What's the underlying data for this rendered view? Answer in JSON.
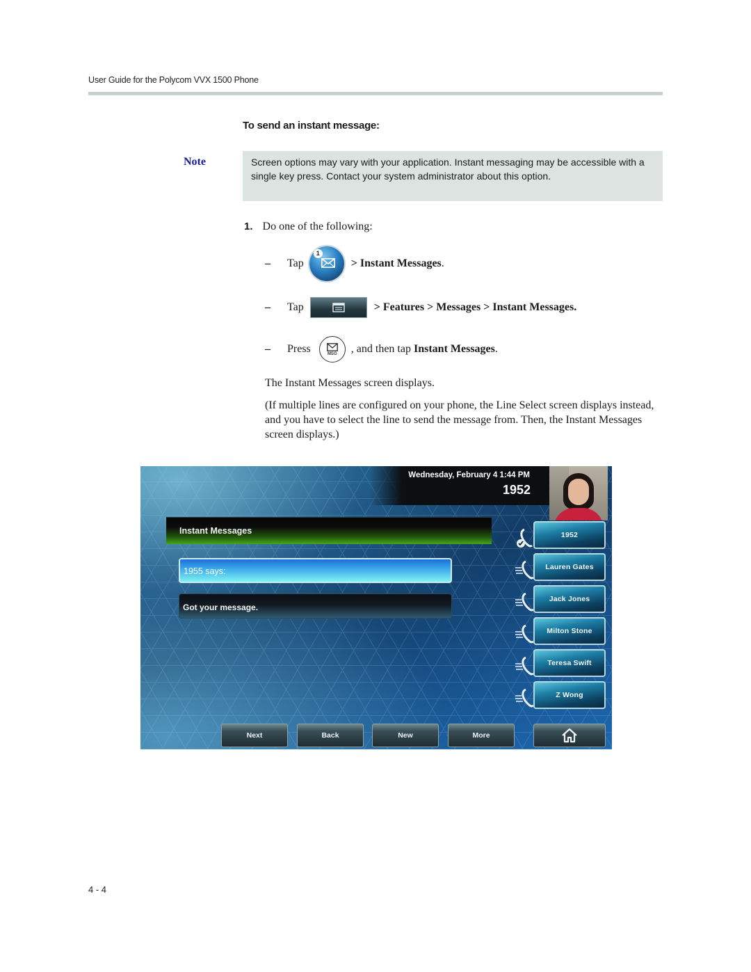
{
  "header": {
    "running_title": "User Guide for the Polycom VVX 1500 Phone"
  },
  "procedure": {
    "title": "To send an instant message:"
  },
  "note": {
    "label": "Note",
    "text": "Screen options may vary with your application. Instant messaging may be accessible with a single key press. Contact your system administrator about this option."
  },
  "steps": [
    {
      "number": "1.",
      "text": "Do one of the following:",
      "options": [
        {
          "lead": "Tap",
          "icon": "messages-orb-icon",
          "badge": "1",
          "path": "> Instant Messages",
          "tail": "."
        },
        {
          "lead": "Tap",
          "icon": "menu-button-icon",
          "path": "> Features > Messages > Instant Messages",
          "tail": "."
        },
        {
          "lead": "Press",
          "icon": "msg-key-icon",
          "key_label": "MSG",
          "mid": ", and then tap ",
          "path": "Instant Messages",
          "tail": "."
        }
      ]
    }
  ],
  "result_paragraphs": [
    "The Instant Messages screen displays.",
    "(If multiple lines are configured on your phone, the Line Select screen displays instead, and you have to select the line to send the message from. Then, the Instant Messages screen displays.)"
  ],
  "phone_screen": {
    "datetime": "Wednesday, February 4  1:44 PM",
    "extension": "1952",
    "title": "Instant Messages",
    "sender": "1955 says:",
    "message": "Got your message.",
    "line_keys": [
      {
        "label": "1952",
        "icon": "phone-registered-icon"
      },
      {
        "label": "Lauren Gates",
        "icon": "phone-speed-dial-icon"
      },
      {
        "label": "Jack Jones",
        "icon": "phone-speed-dial-icon"
      },
      {
        "label": "Milton Stone",
        "icon": "phone-speed-dial-icon"
      },
      {
        "label": "Teresa Swift",
        "icon": "phone-speed-dial-icon"
      },
      {
        "label": "Z Wong",
        "icon": "phone-speed-dial-icon"
      }
    ],
    "soft_keys": [
      "Next",
      "Back",
      "New",
      "More"
    ],
    "home_key_icon": "home-icon",
    "colors": {
      "title_green": "#45a618",
      "selected_cyan": "#7ef3f3",
      "line_key_blue": "#1d7ea6"
    }
  },
  "footer": {
    "page_number": "4 - 4"
  }
}
